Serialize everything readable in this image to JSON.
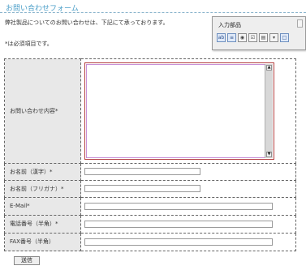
{
  "page": {
    "title": "お問い合わせフォーム",
    "intro": "弊社製品についてのお問い合わせは、下記にて承っております。",
    "required_note": "*は必須項目です。"
  },
  "form": {
    "fields": [
      {
        "label": "お問い合わせ内容*",
        "type": "textarea",
        "value": ""
      },
      {
        "label": "お名前（漢字）*",
        "type": "text",
        "value": ""
      },
      {
        "label": "お名前（フリガナ）*",
        "type": "text",
        "value": ""
      },
      {
        "label": "E-Mail*",
        "type": "text",
        "value": ""
      },
      {
        "label": "電話番号（半角）*",
        "type": "text",
        "value": ""
      },
      {
        "label": "FAX番号（半角）",
        "type": "text",
        "value": ""
      }
    ],
    "submit_label": "送信"
  },
  "toolbar": {
    "title": "入力部品",
    "buttons": [
      {
        "icon": "text-field-icon",
        "glyph": "ab"
      },
      {
        "icon": "textarea-icon",
        "glyph": "≡"
      },
      {
        "icon": "radio-group-icon",
        "glyph": "◉"
      },
      {
        "icon": "checkbox-group-icon",
        "glyph": "☑"
      },
      {
        "icon": "list-box-icon",
        "glyph": "▤"
      },
      {
        "icon": "dropdown-icon",
        "glyph": "▾"
      },
      {
        "icon": "submit-button-icon",
        "glyph": "□"
      }
    ]
  }
}
